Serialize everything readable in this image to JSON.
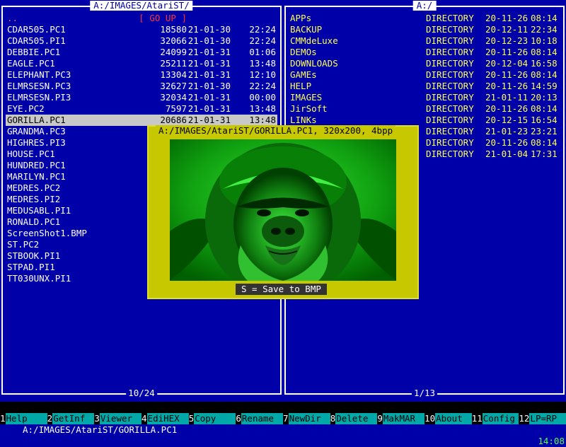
{
  "left_panel": {
    "path": "A:/IMAGES/AtariST/",
    "footer": "10/24",
    "rows": [
      {
        "name": "..",
        "size": "[ GO UP ]",
        "date": "",
        "time": "",
        "type": "parent"
      },
      {
        "name": "CDAR505.PC1",
        "size": "18580",
        "date": "21-01-30",
        "time": "22:24"
      },
      {
        "name": "CDAR505.PI1",
        "size": "32066",
        "date": "21-01-30",
        "time": "22:24"
      },
      {
        "name": "DEBBIE.PC1",
        "size": "24099",
        "date": "21-01-31",
        "time": "01:06"
      },
      {
        "name": "EAGLE.PC1",
        "size": "25211",
        "date": "21-01-31",
        "time": "13:48"
      },
      {
        "name": "ELEPHANT.PC3",
        "size": "13304",
        "date": "21-01-31",
        "time": "12:10"
      },
      {
        "name": "ELMRSESN.PC3",
        "size": "32627",
        "date": "21-01-30",
        "time": "22:24"
      },
      {
        "name": "ELMRSESN.PI3",
        "size": "32034",
        "date": "21-01-31",
        "time": "00:00"
      },
      {
        "name": "EYE.PC2",
        "size": "7597",
        "date": "21-01-31",
        "time": "13:48"
      },
      {
        "name": "GORILLA.PC1",
        "size": "20686",
        "date": "21-01-31",
        "time": "13:48",
        "type": "selected"
      },
      {
        "name": "GRANDMA.PC3",
        "size": "",
        "date": "",
        "time": ""
      },
      {
        "name": "HIGHRES.PI3",
        "size": "",
        "date": "",
        "time": ""
      },
      {
        "name": "HOUSE.PC1",
        "size": "",
        "date": "",
        "time": ""
      },
      {
        "name": "HUNDRED.PC1",
        "size": "",
        "date": "",
        "time": ""
      },
      {
        "name": "MARILYN.PC1",
        "size": "",
        "date": "",
        "time": ""
      },
      {
        "name": "MEDRES.PC2",
        "size": "",
        "date": "",
        "time": ""
      },
      {
        "name": "MEDRES.PI2",
        "size": "",
        "date": "",
        "time": ""
      },
      {
        "name": "MEDUSABL.PI1",
        "size": "",
        "date": "",
        "time": ""
      },
      {
        "name": "RONALD.PC1",
        "size": "",
        "date": "",
        "time": ""
      },
      {
        "name": "ScreenShot1.BMP",
        "size": "",
        "date": "",
        "time": ""
      },
      {
        "name": "ST.PC2",
        "size": "",
        "date": "",
        "time": ""
      },
      {
        "name": "STBOOK.PI1",
        "size": "",
        "date": "",
        "time": ""
      },
      {
        "name": "STPAD.PI1",
        "size": "",
        "date": "",
        "time": ""
      },
      {
        "name": "TT030UNX.PI1",
        "size": "",
        "date": "",
        "time": ""
      }
    ]
  },
  "right_panel": {
    "path": "A:/",
    "footer": "1/13",
    "rows": [
      {
        "name": "APPs",
        "size": "DIRECTORY",
        "date": "20-11-26",
        "time": "08:14"
      },
      {
        "name": "BACKUP",
        "size": "DIRECTORY",
        "date": "20-12-11",
        "time": "22:34"
      },
      {
        "name": "CMMdeLuxe",
        "size": "DIRECTORY",
        "date": "20-12-23",
        "time": "10:18"
      },
      {
        "name": "DEMOs",
        "size": "DIRECTORY",
        "date": "20-11-26",
        "time": "08:14"
      },
      {
        "name": "DOWNLOADS",
        "size": "DIRECTORY",
        "date": "20-12-04",
        "time": "16:58"
      },
      {
        "name": "GAMEs",
        "size": "DIRECTORY",
        "date": "20-11-26",
        "time": "08:14"
      },
      {
        "name": "HELP",
        "size": "DIRECTORY",
        "date": "20-11-26",
        "time": "14:59"
      },
      {
        "name": "IMAGES",
        "size": "DIRECTORY",
        "date": "21-01-11",
        "time": "20:13"
      },
      {
        "name": "JirSoft",
        "size": "DIRECTORY",
        "date": "20-11-26",
        "time": "08:14"
      },
      {
        "name": "LINKs",
        "size": "DIRECTORY",
        "date": "20-12-15",
        "time": "16:54"
      },
      {
        "name": "",
        "size": "DIRECTORY",
        "date": "21-01-23",
        "time": "23:21"
      },
      {
        "name": "",
        "size": "DIRECTORY",
        "date": "20-11-26",
        "time": "08:14"
      },
      {
        "name": "",
        "size": "DIRECTORY",
        "date": "21-01-04",
        "time": "17:31"
      }
    ]
  },
  "preview": {
    "title": "A:/IMAGES/AtariST/GORILLA.PC1, 320x200, 4bpp",
    "save_hint": "S = Save to BMP"
  },
  "command_line": {
    "marks": "∇ †",
    "path": "A:/IMAGES/AtariST/GORILLA.PC1",
    "clock": "14:08"
  },
  "fkeys": [
    {
      "num": "1",
      "label": "Help"
    },
    {
      "num": "2",
      "label": "GetInf"
    },
    {
      "num": "3",
      "label": "Viewer"
    },
    {
      "num": "4",
      "label": "EdiHEX"
    },
    {
      "num": "5",
      "label": "Copy"
    },
    {
      "num": "6",
      "label": "Rename"
    },
    {
      "num": "7",
      "label": "NewDir"
    },
    {
      "num": "8",
      "label": "Delete"
    },
    {
      "num": "9",
      "label": "MakMAR"
    },
    {
      "num": "10",
      "label": "About"
    },
    {
      "num": "11",
      "label": "Config"
    },
    {
      "num": "12",
      "label": "LP=RP"
    }
  ],
  "colors": {
    "background": "#0000a8",
    "dir_text": "#ffff55",
    "preview_frame": "#c8c800",
    "fkey_label": "#00a8a8"
  }
}
